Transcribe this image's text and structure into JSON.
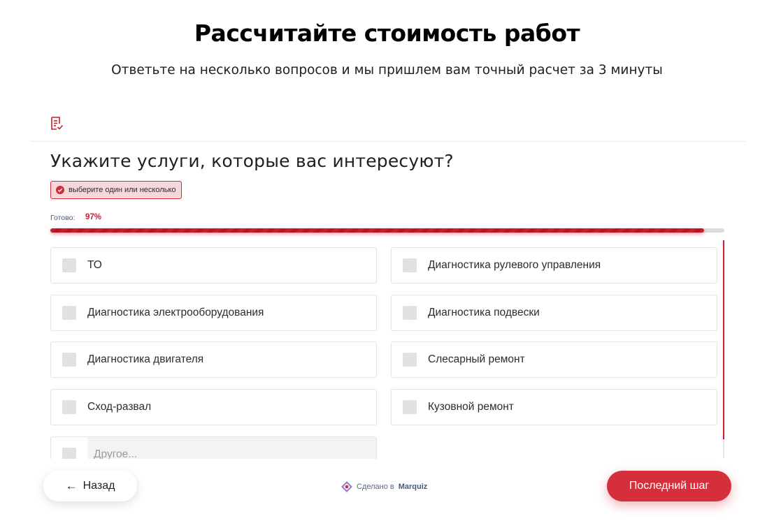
{
  "header": {
    "title": "Рассчитайте стоимость работ",
    "subtitle": "Ответьте на несколько вопросов и мы пришлем вам точный расчет за 3 минуты"
  },
  "question": {
    "icon": "checklist-icon",
    "title": "Укажите услуги, которые вас интересуют?",
    "hint": "выберите один или несколько"
  },
  "progress": {
    "label": "Готово:",
    "value_text": "97%",
    "value": 0.97
  },
  "options": [
    {
      "label": "ТО",
      "checked": false
    },
    {
      "label": "Диагностика рулевого управления",
      "checked": false
    },
    {
      "label": "Диагностика электрооборудования",
      "checked": false
    },
    {
      "label": "Диагностика подвески",
      "checked": false
    },
    {
      "label": "Диагностика двигателя",
      "checked": false
    },
    {
      "label": "Слесарный ремонт",
      "checked": false
    },
    {
      "label": "Сход-развал",
      "checked": false
    },
    {
      "label": "Кузовной ремонт",
      "checked": false
    }
  ],
  "other_option": {
    "placeholder": "Другое...",
    "value": ""
  },
  "footer": {
    "back_label": "Назад",
    "made_in_prefix": "Сделано в",
    "made_in_brand": "Marquiz",
    "next_label": "Последний шаг"
  },
  "colors": {
    "accent": "#d62f3c",
    "progress": "#c71e2d",
    "hint_bg": "#f6d7da"
  }
}
